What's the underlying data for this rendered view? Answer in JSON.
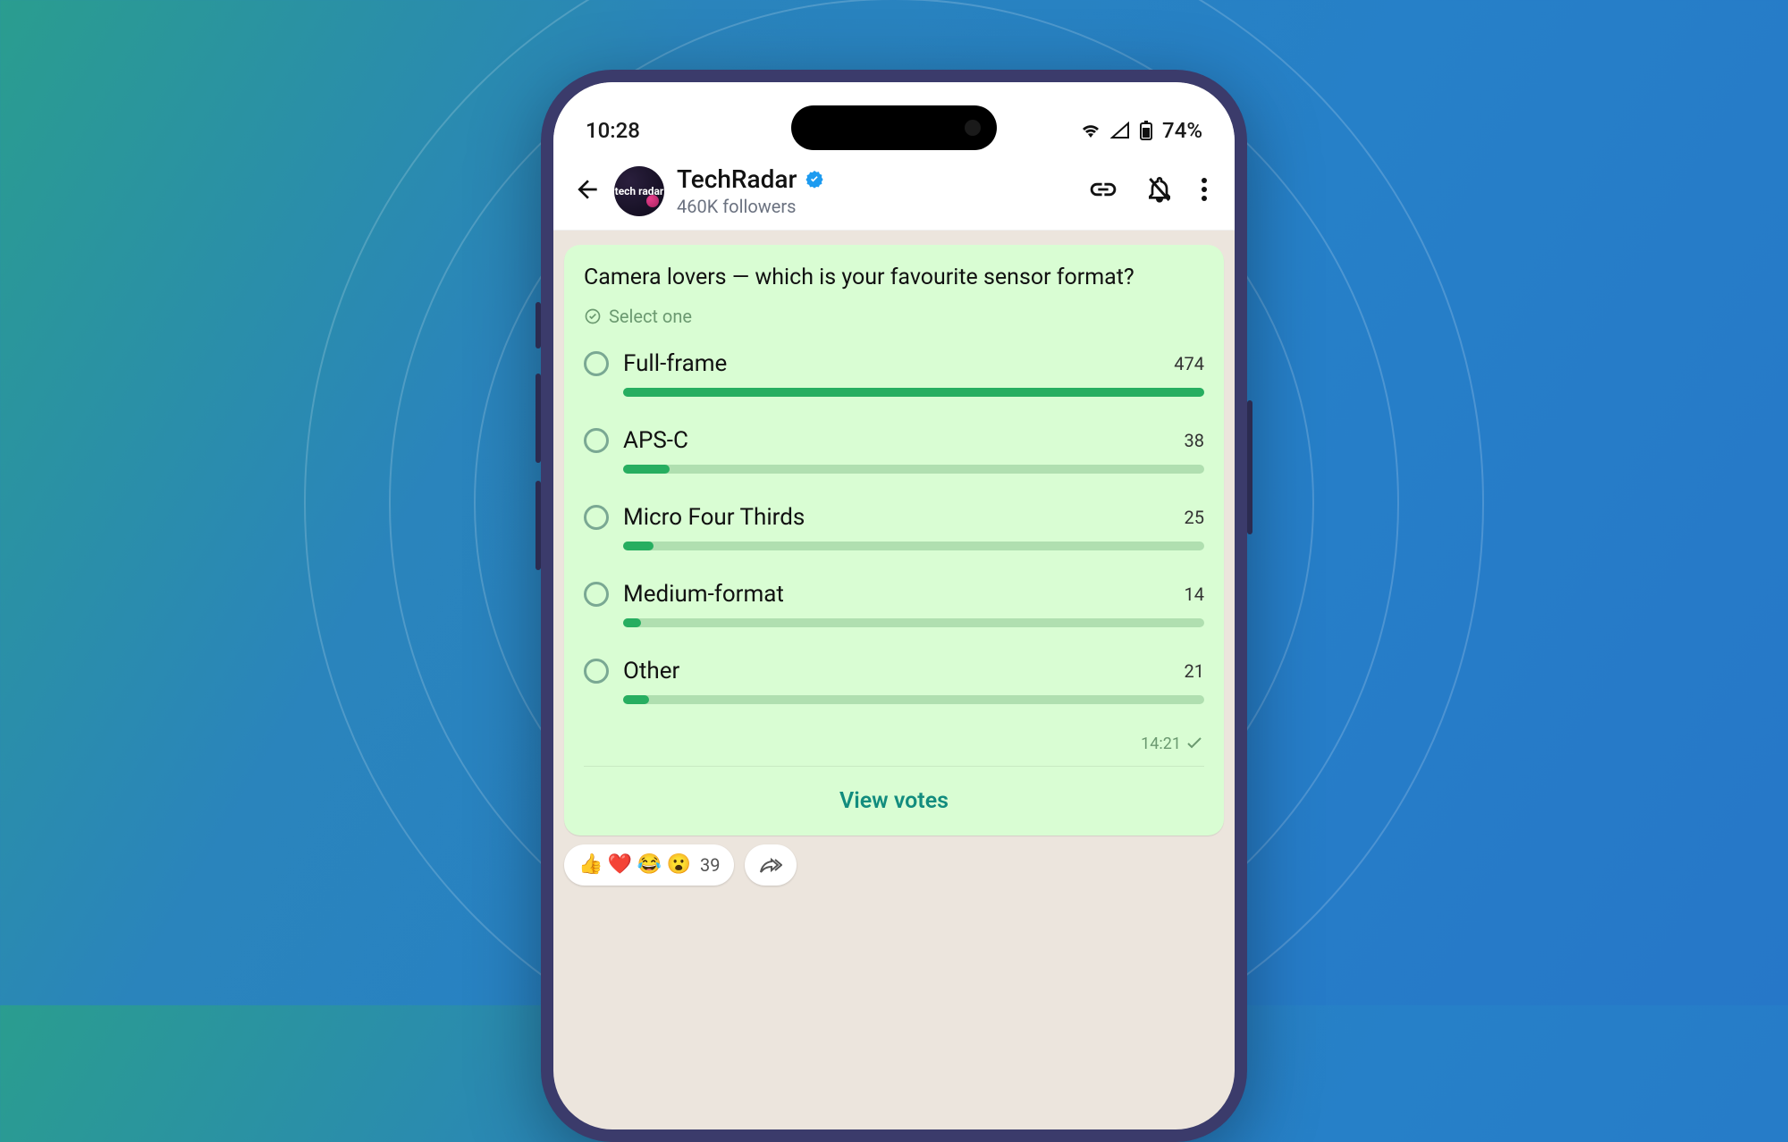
{
  "status": {
    "time": "10:28",
    "battery": "74%"
  },
  "header": {
    "channel_name": "TechRadar",
    "subtitle": "460K followers",
    "avatar_label": "tech radar"
  },
  "poll": {
    "question": "Camera lovers — which is your favourite sensor format?",
    "select_hint": "Select one",
    "options": [
      {
        "label": "Full-frame",
        "count": "474",
        "pct": 100
      },
      {
        "label": "APS-C",
        "count": "38",
        "pct": 8
      },
      {
        "label": "Micro Four Thirds",
        "count": "25",
        "pct": 5.3
      },
      {
        "label": "Medium-format",
        "count": "14",
        "pct": 3
      },
      {
        "label": "Other",
        "count": "21",
        "pct": 4.4
      }
    ],
    "timestamp": "14:21",
    "view_votes": "View votes"
  },
  "reactions": {
    "emojis": "👍 ❤️ 😂 😮",
    "count": "39"
  }
}
